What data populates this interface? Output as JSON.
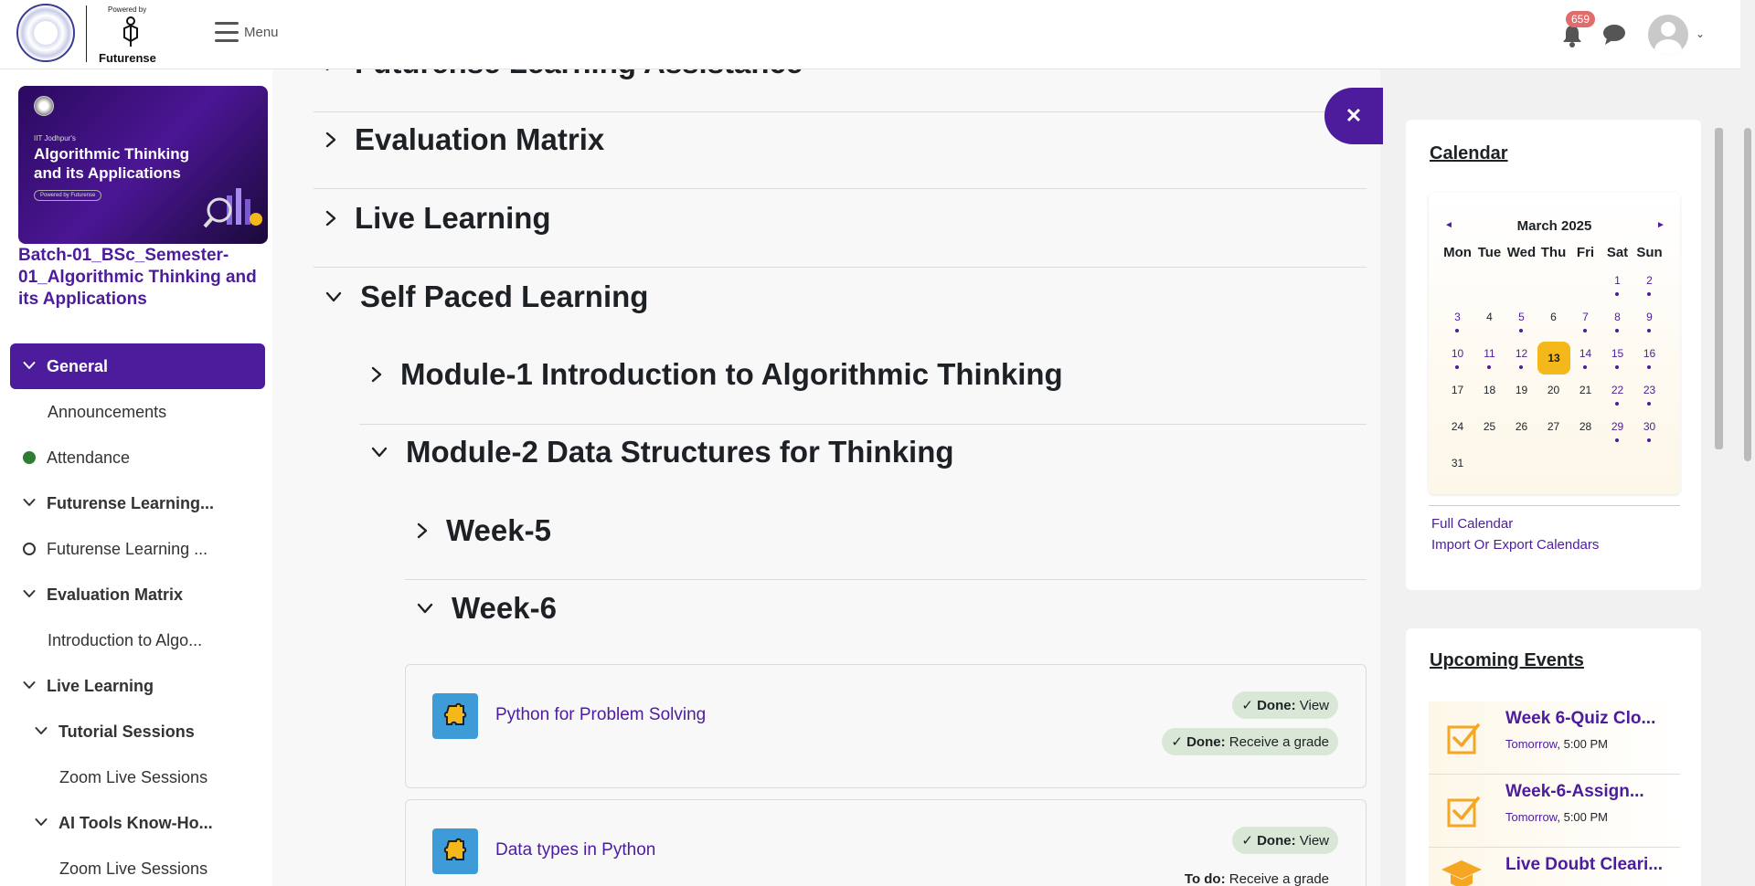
{
  "navbar": {
    "powered_by": "Powered by",
    "brand": "Futurense",
    "menu_label": "Menu",
    "notification_count": "659"
  },
  "drawer": {
    "course_image": {
      "subtitle": "IIT Jodhpur's",
      "title": "Algorithmic Thinking and its Applications",
      "powered": "Powered by Futurense"
    },
    "course_name": "Batch-01_BSc_Semester-01_Algorithmic Thinking and its Applications",
    "items": [
      {
        "label": "General",
        "type": "active"
      },
      {
        "label": "Announcements",
        "type": "plain"
      },
      {
        "label": "Attendance",
        "type": "green-dot"
      },
      {
        "label": "Futurense Learning...",
        "type": "section"
      },
      {
        "label": "Futurense Learning ...",
        "type": "ring"
      },
      {
        "label": "Evaluation Matrix",
        "type": "section"
      },
      {
        "label": "Introduction to Algo...",
        "type": "plain"
      },
      {
        "label": "Live Learning",
        "type": "section"
      },
      {
        "label": "Tutorial Sessions",
        "type": "subsection"
      },
      {
        "label": "Zoom Live Sessions",
        "type": "subplain"
      },
      {
        "label": "AI Tools Know-Ho...",
        "type": "subsection"
      },
      {
        "label": "Zoom Live Sessions",
        "type": "subplain"
      }
    ]
  },
  "main": {
    "sections": [
      {
        "title": "Futurense Learning Assistance",
        "expanded": false
      },
      {
        "title": "Evaluation Matrix",
        "expanded": false
      },
      {
        "title": "Live Learning",
        "expanded": false
      },
      {
        "title": "Self Paced Learning",
        "expanded": true
      }
    ],
    "modules": [
      {
        "title": "Module-1 Introduction to Algorithmic Thinking",
        "expanded": false
      },
      {
        "title": "Module-2 Data Structures for Thinking",
        "expanded": true
      }
    ],
    "weeks": [
      {
        "title": "Week-5",
        "expanded": false
      },
      {
        "title": "Week-6",
        "expanded": true
      }
    ],
    "activities": [
      {
        "name": "Python for Problem Solving",
        "status1_label": "Done:",
        "status1_value": "View",
        "status2_label": "Done:",
        "status2_value": "Receive a grade"
      },
      {
        "name": "Data types in Python",
        "status1_label": "Done:",
        "status1_value": "View",
        "status2_label": "To do:",
        "status2_value": "Receive a grade"
      }
    ]
  },
  "calendar": {
    "title": "Calendar",
    "month": "March 2025",
    "prev": "◄",
    "next": "►",
    "days_of_week": [
      "Mon",
      "Tue",
      "Wed",
      "Thu",
      "Fri",
      "Sat",
      "Sun"
    ],
    "today": 13,
    "event_days": [
      1,
      2,
      3,
      5,
      7,
      8,
      9,
      10,
      11,
      12,
      14,
      15,
      16,
      22,
      23,
      29,
      30
    ],
    "full_calendar_link": "Full Calendar",
    "import_export_link": "Import Or Export Calendars"
  },
  "upcoming": {
    "title": "Upcoming Events",
    "events": [
      {
        "title": "Week 6-Quiz Clo...",
        "day": "Tomorrow",
        "time": ", 5:00 PM",
        "icon": "checkbox-icon"
      },
      {
        "title": "Week-6-Assign...",
        "day": "Tomorrow",
        "time": ", 5:00 PM",
        "icon": "checkbox-icon"
      },
      {
        "title": "Live Doubt Cleari...",
        "day": "",
        "time": "",
        "icon": "graduation-cap-icon"
      }
    ]
  },
  "colors": {
    "brand": "#4c1c9c",
    "today": "#f5b81b",
    "done_pill": "#d9e8d6"
  }
}
